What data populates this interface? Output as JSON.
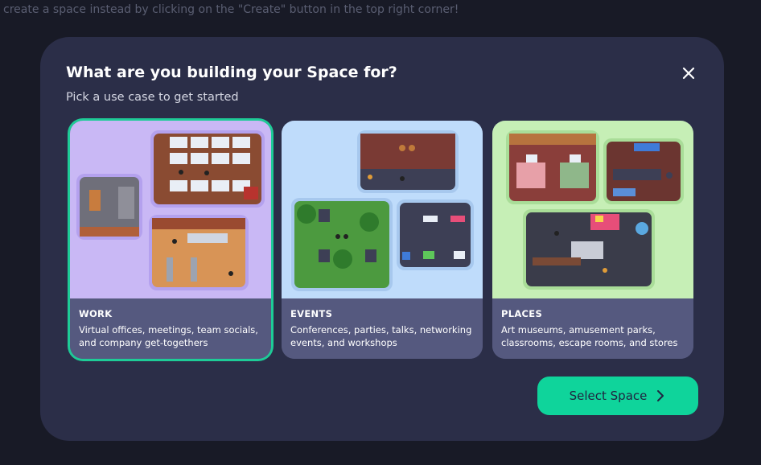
{
  "background": {
    "hint": "create a space instead by clicking on the \"Create\" button in the top right corner!"
  },
  "modal": {
    "title": "What are you building your Space for?",
    "subtitle": "Pick a use case to get started",
    "close_icon": "close-icon"
  },
  "cards": [
    {
      "label": "WORK",
      "description_line1": "Virtual offices, meetings, team socials,",
      "description_line2": "and company get-togethers",
      "selected": true,
      "art_bg": "#c9b8f5"
    },
    {
      "label": "EVENTS",
      "description_line1": "Conferences, parties, talks, networking",
      "description_line2": "events, and workshops",
      "selected": false,
      "art_bg": "#bfdcfb"
    },
    {
      "label": "PLACES",
      "description_line1": "Art museums, amusement parks,",
      "description_line2": "classrooms, escape rooms, and stores",
      "selected": false,
      "art_bg": "#c6efb6"
    }
  ],
  "action": {
    "select_label": "Select Space",
    "icon": "chevron-right-icon"
  },
  "colors": {
    "accent": "#0fd49b",
    "modal_bg": "#2b2e48",
    "card_info_bg": "#55597f",
    "selected_outline": "#1ecb97"
  }
}
